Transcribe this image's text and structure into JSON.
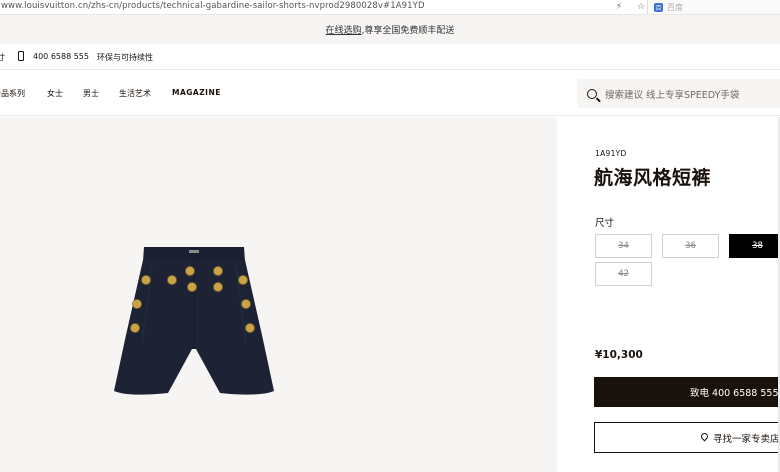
{
  "browser": {
    "url": "www.louisvuitton.cn/zhs-cn/products/technical-gabardine-sailor-shorts-nvprod2980028v#1A91YD",
    "search_engine_label": "百度"
  },
  "banner": {
    "link_text": "在线选购",
    "text": ",尊享全国免费顺丰配送"
  },
  "utility": {
    "fragment": "寸",
    "phone": "400 6588 555",
    "sustainability": "环保与可持续性"
  },
  "nav": {
    "items": [
      "新品系列",
      "女士",
      "男士",
      "生活艺术",
      "MAGAZINE"
    ],
    "search_placeholder": "搜索建议  线上专享SPEEDY手袋"
  },
  "product": {
    "sku": "1A91YD",
    "title": "航海风格短裤",
    "size_label": "尺寸",
    "sizes": [
      {
        "label": "34",
        "selected": false
      },
      {
        "label": "36",
        "selected": false
      },
      {
        "label": "38",
        "selected": true
      },
      {
        "label": "42",
        "selected": false
      }
    ],
    "price": "¥10,300",
    "call_button": "致电 400 6588 555 咨",
    "store_button": "寻找一家专卖店"
  },
  "colors": {
    "accent": "#19110b",
    "panel_bg": "#f6f5f3",
    "shorts_navy": "#1d2335",
    "button_gold": "#c9a24a"
  }
}
